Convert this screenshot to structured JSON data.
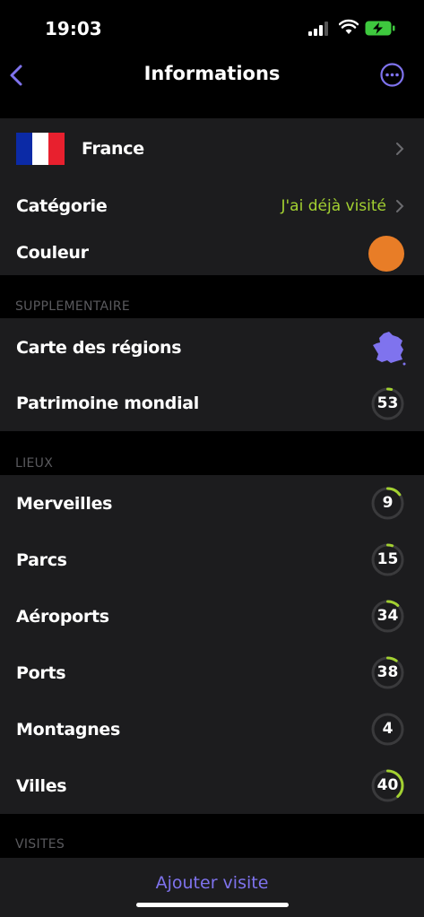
{
  "status": {
    "time": "19:03"
  },
  "nav": {
    "title": "Informations",
    "back_icon": "chevron-left-icon",
    "more_icon": "ellipsis-circle-icon"
  },
  "colors": {
    "accent": "#7f73ee",
    "green": "#a3d131",
    "orange": "#e87d27",
    "group_bg": "#1c1c1e"
  },
  "country": {
    "name": "France",
    "flag": [
      "#0b2aa6",
      "#ffffff",
      "#e8202e"
    ]
  },
  "category": {
    "label": "Catégorie",
    "value": "J'ai déjà visité"
  },
  "couleur": {
    "label": "Couleur",
    "color": "#e87d27"
  },
  "supplementaire": {
    "header": "SUPPLEMENTAIRE",
    "items": [
      {
        "label": "Carte des régions",
        "icon": "france-map-icon"
      },
      {
        "label": "Patrimoine mondial",
        "count": "53",
        "progress": 0.04
      }
    ]
  },
  "lieux": {
    "header": "LIEUX",
    "items": [
      {
        "label": "Merveilles",
        "count": "9",
        "progress": 0.15
      },
      {
        "label": "Parcs",
        "count": "15",
        "progress": 0.05
      },
      {
        "label": "Aéroports",
        "count": "34",
        "progress": 0.12
      },
      {
        "label": "Ports",
        "count": "38",
        "progress": 0.1
      },
      {
        "label": "Montagnes",
        "count": "4",
        "progress": 0
      },
      {
        "label": "Villes",
        "count": "40",
        "progress": 0.38
      }
    ]
  },
  "visites": {
    "header": "VISITES"
  },
  "bottom": {
    "add_label": "Ajouter visite"
  }
}
